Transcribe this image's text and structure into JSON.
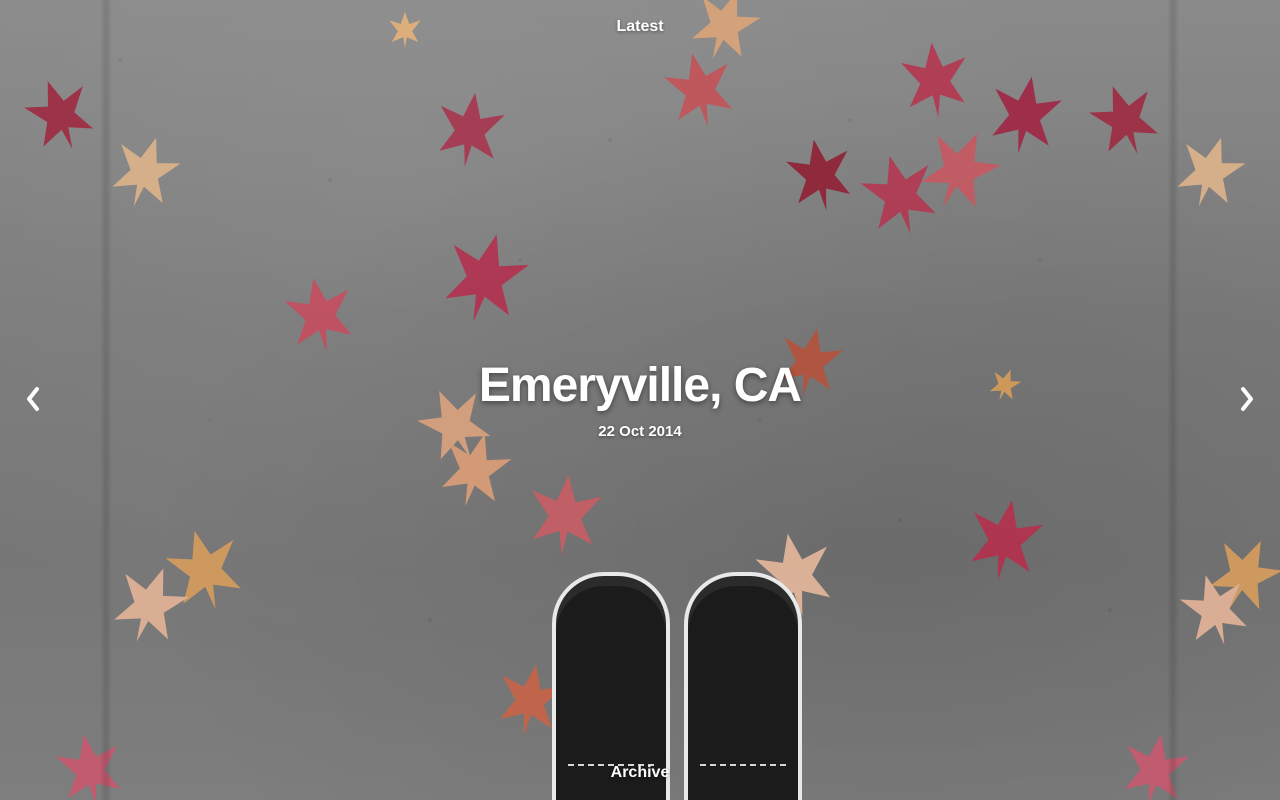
{
  "nav": {
    "latest_label": "Latest",
    "archive_label": "Archive"
  },
  "post": {
    "title": "Emeryville, CA",
    "date": "22 Oct 2014"
  },
  "icons": {
    "prev": "chevron-left-icon",
    "next": "chevron-right-icon"
  },
  "colors": {
    "text": "#ffffff",
    "pavement": "#7d7d7d",
    "leaf_red": "#b0384f",
    "leaf_tan": "#d9a47a"
  }
}
